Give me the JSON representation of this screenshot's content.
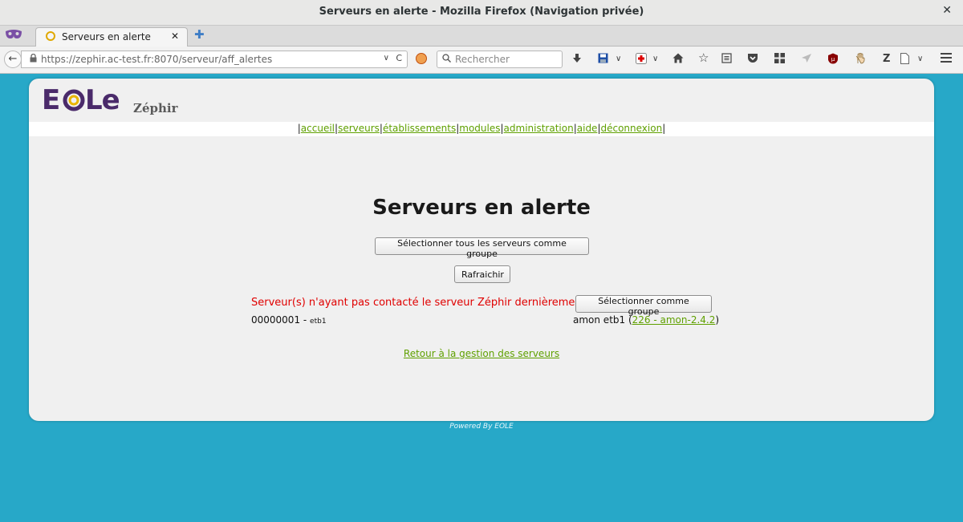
{
  "window": {
    "title": "Serveurs en alerte - Mozilla Firefox (Navigation privée)",
    "close_glyph": "✕"
  },
  "tabs": [
    {
      "label": "Serveurs en alerte",
      "close_glyph": "✕"
    }
  ],
  "newtab_glyph": "✚",
  "nav": {
    "back_glyph": "←",
    "url": "https://zephir.ac-test.fr:8070/serveur/aff_alertes",
    "reload_glyph": "C",
    "dropdown_glyph": "∨",
    "search_placeholder": "Rechercher"
  },
  "toolbar_icons": [
    "download-icon",
    "save-icon",
    "save-menu-icon",
    "addon-icon",
    "addon-menu-icon",
    "home-icon",
    "bookmark-star-icon",
    "reading-list-icon",
    "pocket-icon",
    "grid-icon",
    "send-icon",
    "ublock-icon",
    "hand-icon",
    "zotero-icon",
    "page-icon",
    "page-menu-icon",
    "menu-icon"
  ],
  "page": {
    "logo_text": "EOLe",
    "app_name": "Zéphir",
    "menu": [
      {
        "label": "accueil"
      },
      {
        "label": "serveurs"
      },
      {
        "label": "établissements"
      },
      {
        "label": "modules"
      },
      {
        "label": "administration"
      },
      {
        "label": "aide"
      },
      {
        "label": "déconnexion"
      }
    ],
    "title": "Serveurs en alerte",
    "select_all_button": "Sélectionner tous les serveurs comme groupe",
    "refresh_button": "Rafraichir",
    "alert_message": "Serveur(s) n'ayant pas contacté le serveur Zéphir dernièrement",
    "select_group_button": "Sélectionner comme groupe",
    "server": {
      "id": "00000001",
      "dash": " - ",
      "etab": "etb1",
      "info_prefix": "amon etb1 (",
      "link": "226 - amon-2.4.2",
      "info_suffix": ")"
    },
    "back_link": "Retour à la gestion des serveurs",
    "powered_by": "Powered By EOLE"
  },
  "colors": {
    "background": "#27a8c8",
    "link": "#5fa000",
    "alert": "#e00000"
  }
}
